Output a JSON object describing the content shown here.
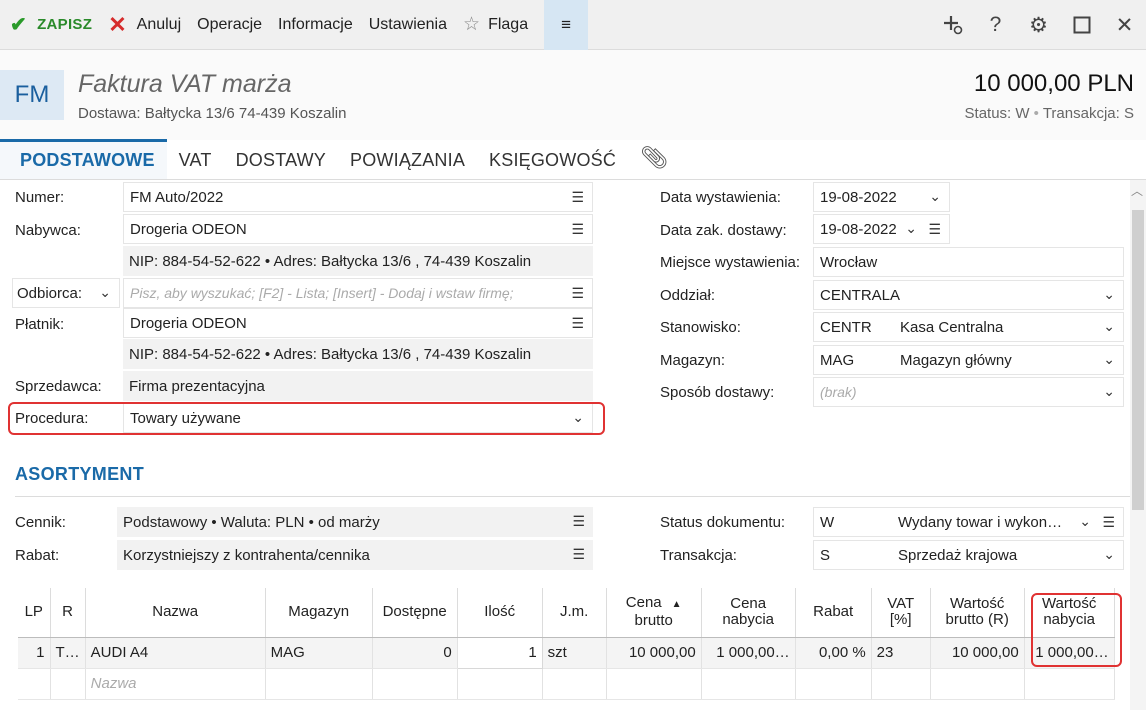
{
  "toolbar": {
    "save": "ZAPISZ",
    "cancel": "Anuluj",
    "operations": "Operacje",
    "information": "Informacje",
    "settings": "Ustawienia",
    "flag": "Flaga",
    "menu_icon": "hamburger-icon",
    "right_icons": [
      "add-related-icon",
      "help-icon",
      "gear-icon",
      "maximize-icon",
      "close-icon"
    ]
  },
  "header": {
    "badge": "FM",
    "title": "Faktura VAT marża",
    "subtitle": "Dostawa: Bałtycka  13/6  74-439 Koszalin",
    "amount": "10 000,00 PLN",
    "status_label": "Status:",
    "status_value": "W",
    "transaction_label": "Transakcja:",
    "transaction_value": "S"
  },
  "tabs": [
    "PODSTAWOWE",
    "VAT",
    "DOSTAWY",
    "POWIĄZANIA",
    "KSIĘGOWOŚĆ"
  ],
  "left_form": {
    "numer_label": "Numer:",
    "numer_value": "FM Auto/2022",
    "nabywca_label": "Nabywca:",
    "nabywca_value": "Drogeria ODEON",
    "nabywca_info": "NIP:  884-54-52-622  •  Adres:  Bałtycka  13/6 , 74-439 Koszalin",
    "odbiorca_select": "Odbiorca:",
    "odbiorca_placeholder": "Pisz, aby wyszukać; [F2] - Lista; [Insert] - Dodaj i wstaw firmę;",
    "platnik_label": "Płatnik:",
    "platnik_value": "Drogeria ODEON",
    "platnik_info": "NIP:  884-54-52-622  •  Adres:  Bałtycka  13/6 , 74-439 Koszalin",
    "sprzedawca_label": "Sprzedawca:",
    "sprzedawca_value": "Firma prezentacyjna",
    "procedura_label": "Procedura:",
    "procedura_value": "Towary używane"
  },
  "right_form": {
    "data_wyst_label": "Data wystawienia:",
    "data_wyst_value": "19-08-2022",
    "data_zak_label": "Data zak. dostawy:",
    "data_zak_value": "19-08-2022",
    "miejsce_label": "Miejsce wystawienia:",
    "miejsce_value": "Wrocław",
    "oddzial_label": "Oddział:",
    "oddzial_value": "CENTRALA",
    "stanowisko_label": "Stanowisko:",
    "stanowisko_code": "CENTR",
    "stanowisko_name": "Kasa Centralna",
    "magazyn_label": "Magazyn:",
    "magazyn_code": "MAG",
    "magazyn_name": "Magazyn główny",
    "sposob_label": "Sposób dostawy:",
    "sposob_value": "(brak)"
  },
  "assortment": {
    "title": "ASORTYMENT",
    "cennik_label": "Cennik:",
    "cennik_value": "Podstawowy • Waluta: PLN • od marży",
    "rabat_label": "Rabat:",
    "rabat_value": "Korzystniejszy z kontrahenta/cennika",
    "status_label": "Status dokumentu:",
    "status_code": "W",
    "status_name": "Wydany towar i wykon…",
    "transakcja_label": "Transakcja:",
    "transakcja_code": "S",
    "transakcja_name": "Sprzedaż krajowa"
  },
  "table": {
    "headers": [
      {
        "l1": "LP",
        "l2": ""
      },
      {
        "l1": "R",
        "l2": ""
      },
      {
        "l1": "Nazwa",
        "l2": ""
      },
      {
        "l1": "Magazyn",
        "l2": ""
      },
      {
        "l1": "Dostępne",
        "l2": ""
      },
      {
        "l1": "Ilość",
        "l2": ""
      },
      {
        "l1": "J.m.",
        "l2": ""
      },
      {
        "l1": "Cena",
        "l2": "brutto"
      },
      {
        "l1": "Cena",
        "l2": "nabycia"
      },
      {
        "l1": "Rabat",
        "l2": ""
      },
      {
        "l1": "VAT",
        "l2": "[%]"
      },
      {
        "l1": "Wartość",
        "l2": "brutto (R)"
      },
      {
        "l1": "Wartość",
        "l2": "nabycia"
      }
    ],
    "rows": [
      [
        "1",
        "T…",
        "AUDI A4",
        "MAG",
        "0",
        "1",
        "szt",
        "10 000,00",
        "1 000,00…",
        "0,00 %",
        "23",
        "10 000,00",
        "1 000,00…"
      ]
    ],
    "new_row_placeholder": "Nazwa"
  },
  "colors": {
    "accent": "#1a6aa8",
    "save_green": "#2a9a2a",
    "cancel_red": "#d62c2c",
    "highlight_red": "#e03232"
  }
}
